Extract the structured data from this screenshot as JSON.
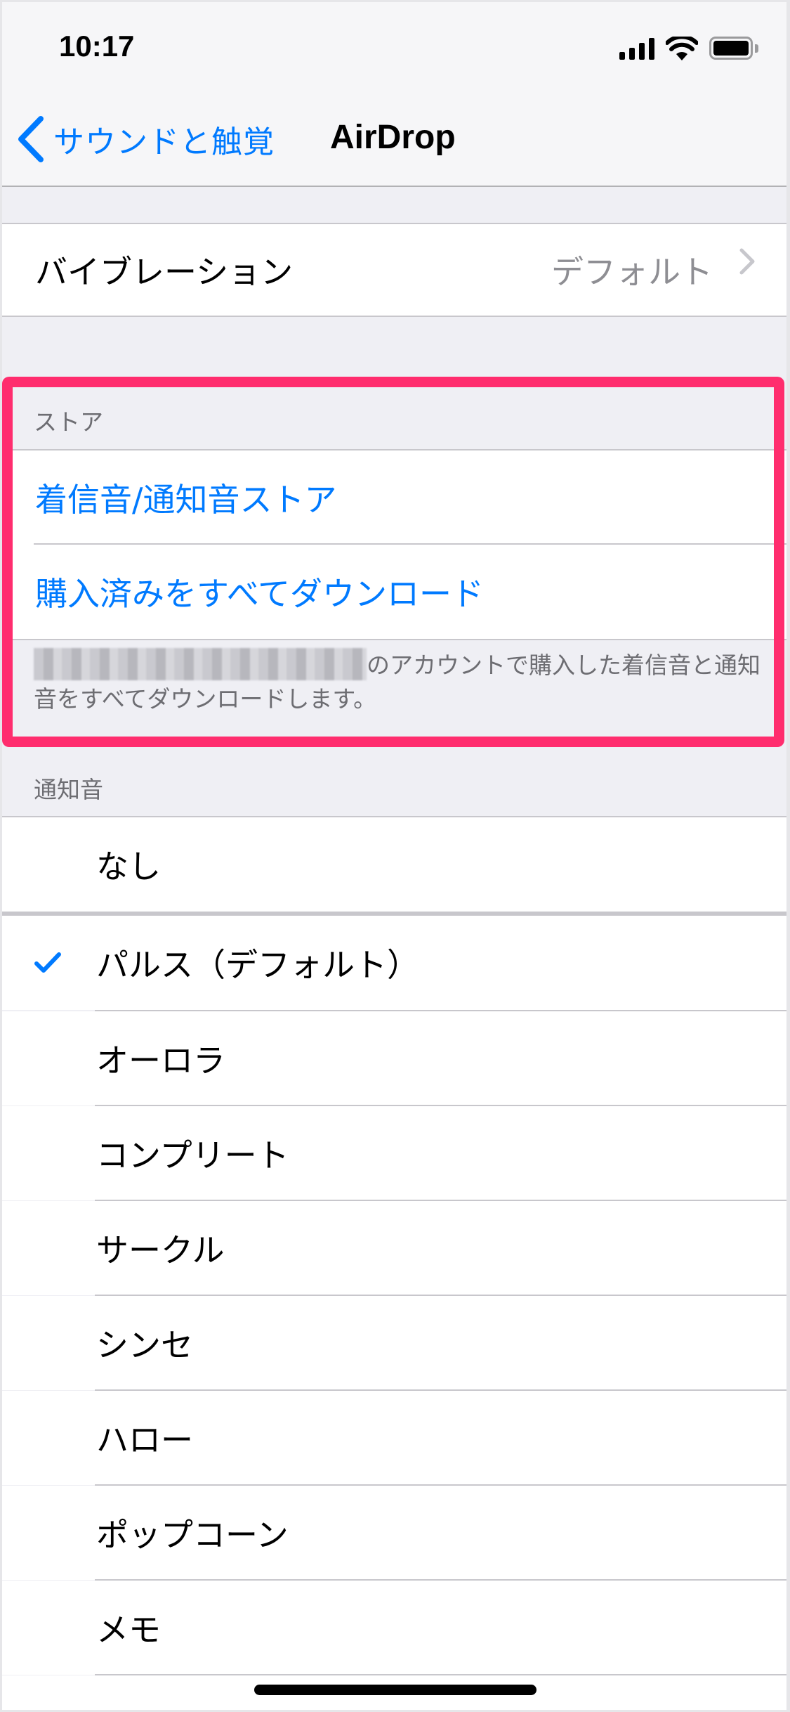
{
  "status_bar": {
    "time": "10:17",
    "icons": [
      "cellular-signal-icon",
      "wifi-icon",
      "battery-icon"
    ]
  },
  "nav": {
    "back_label": "サウンドと触覚",
    "title": "AirDrop"
  },
  "vibration": {
    "label": "バイブレーション",
    "value": "デフォルト"
  },
  "store_section": {
    "header": "ストア",
    "items": [
      {
        "label": "着信音/通知音ストア"
      },
      {
        "label": "購入済みをすべてダウンロード"
      }
    ],
    "footer_redacted": "[redacted email]",
    "footer_text": "のアカウントで購入した着信音と通知音をすべてダウンロードします。"
  },
  "sounds_section": {
    "header": "通知音",
    "none_label": "なし",
    "selected": "パルス（デフォルト）",
    "items": [
      {
        "label": "パルス（デフォルト）",
        "checked": true
      },
      {
        "label": "オーロラ",
        "checked": false
      },
      {
        "label": "コンプリート",
        "checked": false
      },
      {
        "label": "サークル",
        "checked": false
      },
      {
        "label": "シンセ",
        "checked": false
      },
      {
        "label": "ハロー",
        "checked": false
      },
      {
        "label": "ポップコーン",
        "checked": false
      },
      {
        "label": "メモ",
        "checked": false
      }
    ]
  },
  "colors": {
    "accent": "#007AFF",
    "highlight": "#FF2D6E",
    "grouped_background": "#EFEFF4",
    "secondary_text": "#6D6D72",
    "value_text": "#8E8E93"
  }
}
